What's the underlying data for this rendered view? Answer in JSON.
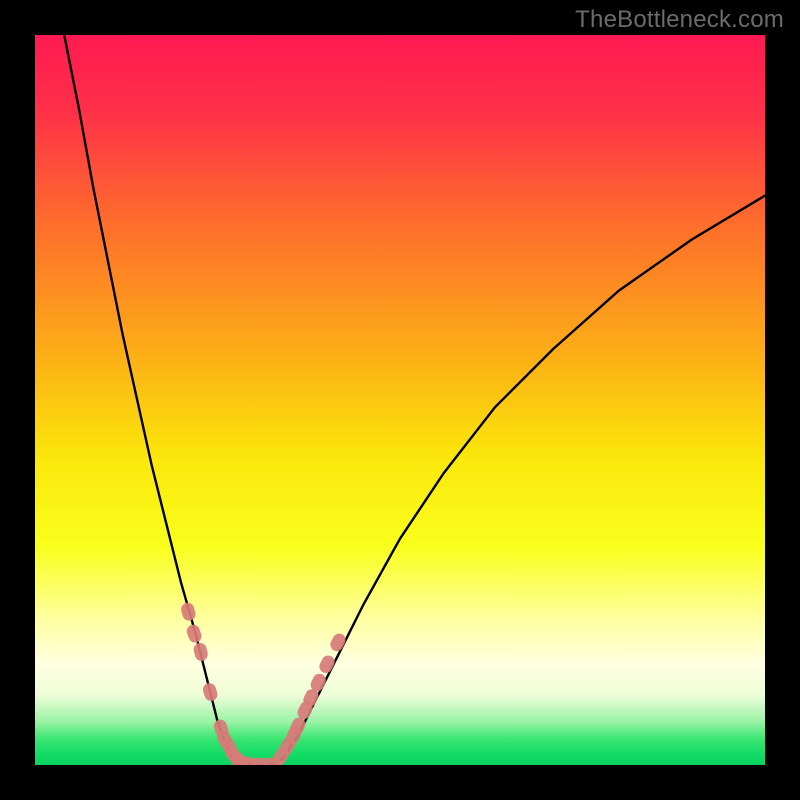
{
  "watermark": {
    "text": "TheBottleneck.com"
  },
  "colors": {
    "frame": "#000000",
    "curve": "#000000",
    "marker_fill": "#d87b78",
    "marker_stroke": "#d87b78",
    "gradient_stops": [
      {
        "offset": 0.0,
        "color": "#ff1a52"
      },
      {
        "offset": 0.1,
        "color": "#ff2f49"
      },
      {
        "offset": 0.25,
        "color": "#fe6a2d"
      },
      {
        "offset": 0.45,
        "color": "#fcb315"
      },
      {
        "offset": 0.58,
        "color": "#fbe70b"
      },
      {
        "offset": 0.7,
        "color": "#f9ff1b"
      },
      {
        "offset": 0.8,
        "color": "#ffffa0"
      },
      {
        "offset": 0.86,
        "color": "#ffffe0"
      },
      {
        "offset": 0.905,
        "color": "#edfdd8"
      },
      {
        "offset": 0.94,
        "color": "#9bf3a6"
      },
      {
        "offset": 0.965,
        "color": "#38e670"
      },
      {
        "offset": 0.985,
        "color": "#13db66"
      },
      {
        "offset": 1.0,
        "color": "#0bd360"
      }
    ]
  },
  "chart_data": {
    "type": "line",
    "title": "",
    "xlabel": "",
    "ylabel": "",
    "xlim": [
      0,
      100
    ],
    "ylim": [
      0,
      100
    ],
    "grid": false,
    "note": "Bottleneck-style V-curve. x is a normalized hardware balance axis (0–100); y is mismatch % where 0 = perfectly balanced (green band) and 100 = worst (red). Values are estimated from pixel positions relative to the plot area; no numeric axes are shown in the source image.",
    "series": [
      {
        "name": "left-branch",
        "type": "line",
        "x": [
          4,
          6,
          8,
          10,
          12,
          14,
          16,
          18,
          20,
          22,
          24,
          25,
          26,
          27,
          27.5
        ],
        "y": [
          100,
          90,
          79,
          69,
          59,
          50,
          41,
          33,
          25,
          18,
          10,
          6,
          3,
          1,
          0
        ]
      },
      {
        "name": "valley-floor",
        "type": "line",
        "x": [
          27.5,
          29,
          31,
          33
        ],
        "y": [
          0,
          0,
          0,
          0
        ]
      },
      {
        "name": "right-branch",
        "type": "line",
        "x": [
          33,
          34,
          36,
          38,
          41,
          45,
          50,
          56,
          63,
          71,
          80,
          90,
          100
        ],
        "y": [
          0,
          1,
          4,
          8,
          14,
          22,
          31,
          40,
          49,
          57,
          65,
          72,
          78
        ]
      },
      {
        "name": "markers-left-branch",
        "type": "scatter",
        "x": [
          21.0,
          21.8,
          22.7,
          24.0,
          25.5,
          26.0,
          26.6,
          27.3,
          28.0,
          29.2,
          30.8,
          32.5
        ],
        "y": [
          21.0,
          18.0,
          15.5,
          10.0,
          5.0,
          3.5,
          2.5,
          1.3,
          0.6,
          0.2,
          0.1,
          0.1
        ]
      },
      {
        "name": "markers-right-branch",
        "type": "scatter",
        "x": [
          33.7,
          34.6,
          35.4,
          36.0,
          37.0,
          37.8,
          38.8,
          40.0,
          41.5
        ],
        "y": [
          1.2,
          2.6,
          4.0,
          5.3,
          7.5,
          9.2,
          11.3,
          13.8,
          16.8
        ]
      }
    ]
  }
}
